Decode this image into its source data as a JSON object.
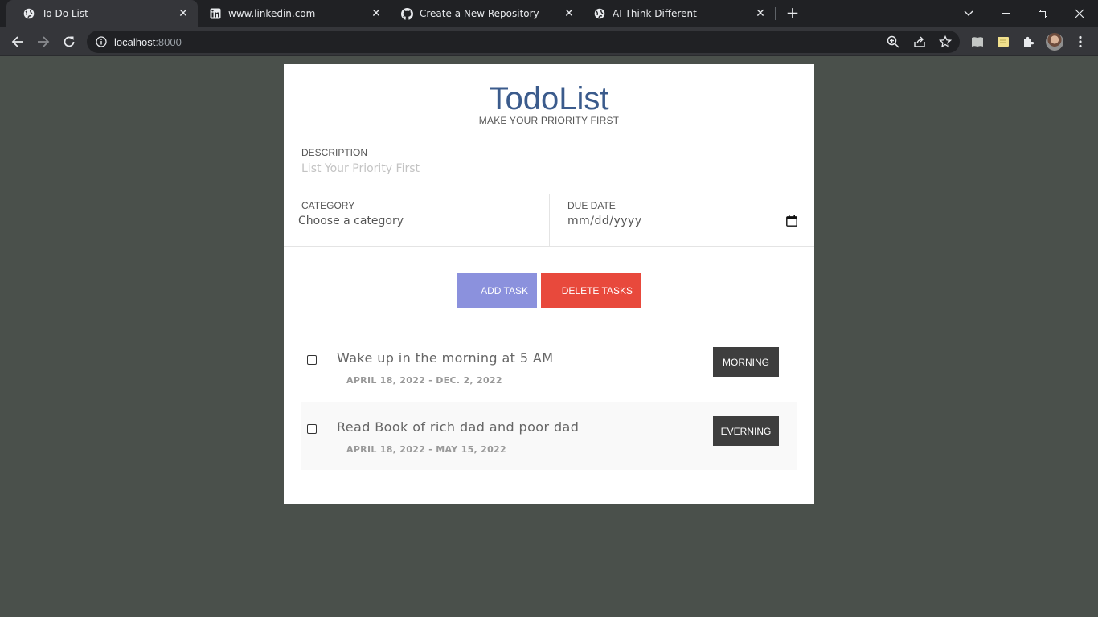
{
  "browser": {
    "tabs": [
      {
        "title": "To Do List",
        "icon": "globe-icon",
        "active": true
      },
      {
        "title": "www.linkedin.com",
        "icon": "linkedin-icon",
        "active": false
      },
      {
        "title": "Create a New Repository",
        "icon": "github-icon",
        "active": false
      },
      {
        "title": "AI Think Different",
        "icon": "globe-icon",
        "active": false
      }
    ],
    "url_host": "localhost",
    "url_port": ":8000"
  },
  "app": {
    "title": "TodoList",
    "subtitle": "MAKE YOUR PRIORITY FIRST",
    "description_label": "DESCRIPTION",
    "description_placeholder": "List Your Priority First",
    "category_label": "CATEGORY",
    "category_value": "Choose a category",
    "due_date_label": "DUE DATE",
    "due_date_value": "mm/dd/yyyy",
    "add_button": "ADD TASK",
    "delete_button": "DELETE TASKS",
    "colors": {
      "title": "#3b5b8c",
      "add_button": "#8b91dd",
      "delete_button": "#e8493c",
      "category_badge": "#3e3e3e"
    }
  },
  "tasks": [
    {
      "text": "Wake up in the morning at 5 AM",
      "dates": "APRIL 18, 2022 - DEC. 2, 2022",
      "category": "MORNING"
    },
    {
      "text": "Read Book of rich dad and poor dad",
      "dates": "APRIL 18, 2022 - MAY 15, 2022",
      "category": "EVERNING"
    }
  ]
}
